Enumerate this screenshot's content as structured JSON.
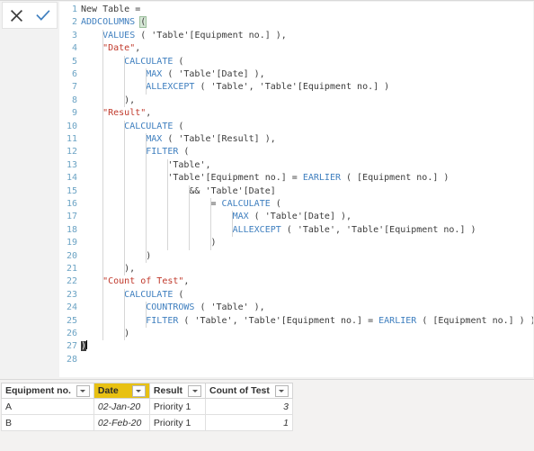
{
  "toolbar": {
    "cancel_label": "Cancel",
    "cancel_icon": "close-x-icon",
    "commit_label": "Apply",
    "commit_icon": "checkmark-icon"
  },
  "editor": {
    "language": "DAX",
    "cursor_line": 27,
    "colors": {
      "keyword": "#3f7fbf",
      "string": "#c0392b",
      "linenumber": "#6ba3c4",
      "plain": "#3b3b3b",
      "bracket_match_bg": "#d7e8d7"
    },
    "lines": [
      {
        "n": "1",
        "text": "New Table ="
      },
      {
        "n": "2",
        "text": "ADDCOLUMNS ("
      },
      {
        "n": "3",
        "text": "    VALUES ( 'Table'[Equipment no.] ),"
      },
      {
        "n": "4",
        "text": "    \"Date\","
      },
      {
        "n": "5",
        "text": "        CALCULATE ("
      },
      {
        "n": "6",
        "text": "            MAX ( 'Table'[Date] ),"
      },
      {
        "n": "7",
        "text": "            ALLEXCEPT ( 'Table', 'Table'[Equipment no.] )"
      },
      {
        "n": "8",
        "text": "        ),"
      },
      {
        "n": "9",
        "text": "    \"Result\","
      },
      {
        "n": "10",
        "text": "        CALCULATE ("
      },
      {
        "n": "11",
        "text": "            MAX ( 'Table'[Result] ),"
      },
      {
        "n": "12",
        "text": "            FILTER ("
      },
      {
        "n": "13",
        "text": "                'Table',"
      },
      {
        "n": "14",
        "text": "                'Table'[Equipment no.] = EARLIER ( [Equipment no.] )"
      },
      {
        "n": "15",
        "text": "                    && 'Table'[Date]"
      },
      {
        "n": "16",
        "text": "                        = CALCULATE ("
      },
      {
        "n": "17",
        "text": "                            MAX ( 'Table'[Date] ),"
      },
      {
        "n": "18",
        "text": "                            ALLEXCEPT ( 'Table', 'Table'[Equipment no.] )"
      },
      {
        "n": "19",
        "text": "                        )"
      },
      {
        "n": "20",
        "text": "            )"
      },
      {
        "n": "21",
        "text": "        ),"
      },
      {
        "n": "22",
        "text": "    \"Count of Test\","
      },
      {
        "n": "23",
        "text": "        CALCULATE ("
      },
      {
        "n": "24",
        "text": "            COUNTROWS ( 'Table' ),"
      },
      {
        "n": "25",
        "text": "            FILTER ( 'Table', 'Table'[Equipment no.] = EARLIER ( [Equipment no.] ) )"
      },
      {
        "n": "26",
        "text": "        )"
      },
      {
        "n": "27",
        "text": ")"
      },
      {
        "n": "28",
        "text": ""
      }
    ]
  },
  "data_table": {
    "columns": [
      {
        "label": "Equipment no.",
        "sorted": false,
        "filter_icon": "chevron-down-icon"
      },
      {
        "label": "Date",
        "sorted": true,
        "filter_icon": "chevron-down-icon"
      },
      {
        "label": "Result",
        "sorted": false,
        "filter_icon": "chevron-down-icon"
      },
      {
        "label": "Count of Test",
        "sorted": false,
        "filter_icon": "chevron-down-icon"
      }
    ],
    "rows": [
      {
        "equipment": "A",
        "date": "02-Jan-20",
        "result": "Priority 1",
        "count": "3"
      },
      {
        "equipment": "B",
        "date": "02-Feb-20",
        "result": "Priority 1",
        "count": "1"
      }
    ],
    "sort_color": "#e8c113"
  }
}
